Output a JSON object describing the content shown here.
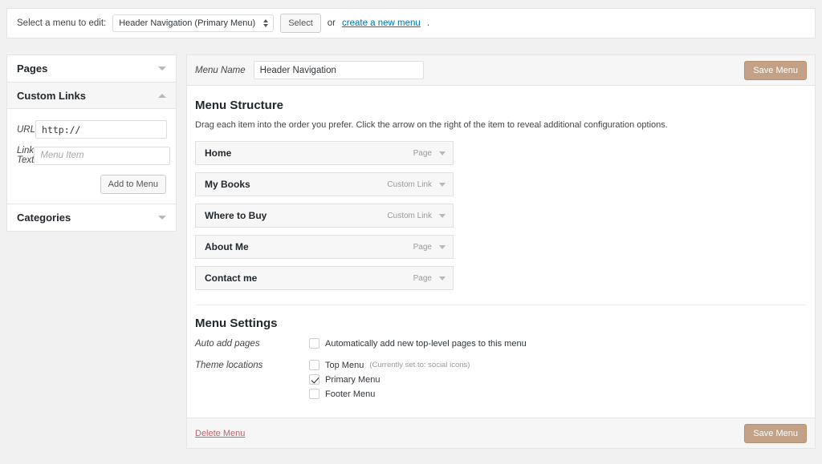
{
  "top_bar": {
    "label": "Select a menu to edit:",
    "selected_menu": "Header Navigation (Primary Menu)",
    "select_button": "Select",
    "or_text": "or",
    "create_link": "create a new menu",
    "period": "."
  },
  "sidebar": {
    "panels": [
      {
        "title": "Pages",
        "state": "collapsed"
      },
      {
        "title": "Custom Links",
        "state": "expanded"
      },
      {
        "title": "Categories",
        "state": "collapsed"
      }
    ],
    "custom_links": {
      "url_label": "URL",
      "url_value": "http://",
      "link_text_label": "Link Text",
      "link_text_placeholder": "Menu Item",
      "add_button": "Add to Menu"
    }
  },
  "main": {
    "menu_name_label": "Menu Name",
    "menu_name_value": "Header Navigation",
    "save_button_top": "Save Menu",
    "structure_title": "Menu Structure",
    "structure_hint": "Drag each item into the order you prefer. Click the arrow on the right of the item to reveal additional configuration options.",
    "items": [
      {
        "title": "Home",
        "type": "Page"
      },
      {
        "title": "My Books",
        "type": "Custom Link"
      },
      {
        "title": "Where to Buy",
        "type": "Custom Link"
      },
      {
        "title": "About Me",
        "type": "Page"
      },
      {
        "title": "Contact me",
        "type": "Page"
      }
    ],
    "settings_title": "Menu Settings",
    "auto_add_label": "Auto add pages",
    "auto_add_text": "Automatically add new top-level pages to this menu",
    "auto_add_checked": false,
    "theme_locations_label": "Theme locations",
    "theme_locations": [
      {
        "label": "Top Menu",
        "note": "(Currently set to: social icons)",
        "checked": false
      },
      {
        "label": "Primary Menu",
        "note": "",
        "checked": true
      },
      {
        "label": "Footer Menu",
        "note": "",
        "checked": false
      }
    ],
    "delete_link": "Delete Menu",
    "save_button_bottom": "Save Menu"
  },
  "colors": {
    "accent_button": "#c2a186",
    "link_blue": "#0073aa",
    "delete_red": "#b5656b",
    "page_bg": "#f1f1f1"
  }
}
